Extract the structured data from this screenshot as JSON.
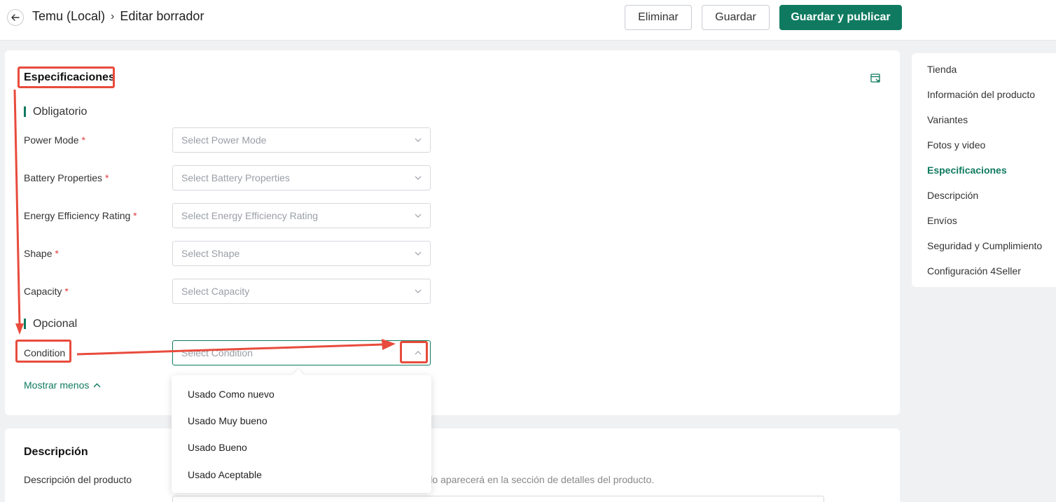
{
  "header": {
    "back_icon": "arrow-left-icon",
    "breadcrumb_store": "Temu (Local)",
    "breadcrumb_sep": "›",
    "breadcrumb_page": "Editar borrador",
    "delete_label": "Eliminar",
    "save_label": "Guardar",
    "publish_label": "Guardar y publicar"
  },
  "specs": {
    "title": "Especificaciones",
    "icon": "collapse-panel-icon",
    "required_group": "Obligatorio",
    "optional_group": "Opcional",
    "required_marker": "*",
    "fields": [
      {
        "label": "Power Mode",
        "placeholder": "Select Power Mode",
        "required": true
      },
      {
        "label": "Battery Properties",
        "placeholder": "Select Battery Properties",
        "required": true
      },
      {
        "label": "Energy Efficiency Rating",
        "placeholder": "Select Energy Efficiency Rating",
        "required": true
      },
      {
        "label": "Shape",
        "placeholder": "Select Shape",
        "required": true
      },
      {
        "label": "Capacity",
        "placeholder": "Select Capacity",
        "required": true
      }
    ],
    "condition": {
      "label": "Condition",
      "placeholder": "Select Condition"
    },
    "show_less": "Mostrar menos",
    "dropdown_options": [
      "Usado Como nuevo",
      "Usado Muy bueno",
      "Usado Bueno",
      "Usado Aceptable"
    ]
  },
  "description": {
    "title": "Descripción",
    "field_label": "Descripción del producto",
    "hint": "tenido aparecerá en la sección de detalles del producto."
  },
  "sidenav": {
    "items": [
      "Tienda",
      "Información del producto",
      "Variantes",
      "Fotos y video",
      "Especificaciones",
      "Descripción",
      "Envíos",
      "Seguridad y Cumplimiento",
      "Configuración 4Seller"
    ],
    "active": "Especificaciones"
  },
  "colors": {
    "accent": "#0f7a5f",
    "annotation": "#e84b3c",
    "required": "#e03c3c"
  }
}
